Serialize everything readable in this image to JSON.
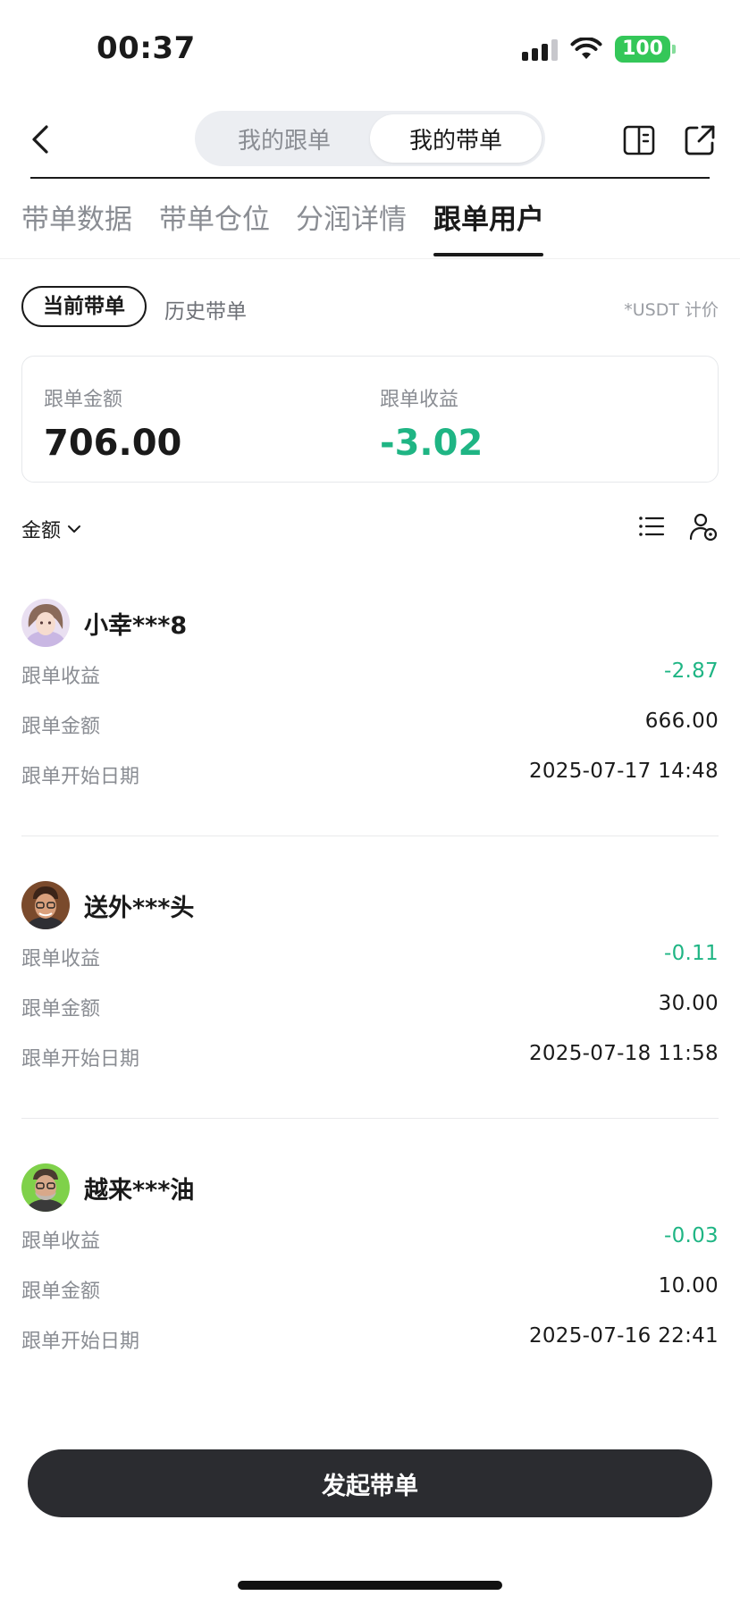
{
  "status_bar": {
    "time": "00:37",
    "battery": "100"
  },
  "header": {
    "segments": [
      "我的跟单",
      "我的带单"
    ],
    "active_segment": 1
  },
  "tabs": [
    "带单数据",
    "带单仓位",
    "分润详情",
    "跟单用户"
  ],
  "active_tab": 3,
  "filter": {
    "current": "当前带单",
    "history": "历史带单",
    "unit_note": "*USDT 计价"
  },
  "summary": {
    "amount_label": "跟单金额",
    "amount_value": "706.00",
    "pnl_label": "跟单收益",
    "pnl_value": "-3.02"
  },
  "sort": {
    "label": "金额"
  },
  "followers": [
    {
      "name": "小幸***8",
      "pnl_label": "跟单收益",
      "pnl": "-2.87",
      "amount_label": "跟单金额",
      "amount": "666.00",
      "date_label": "跟单开始日期",
      "date": "2025-07-17 14:48"
    },
    {
      "name": "送外***头",
      "pnl_label": "跟单收益",
      "pnl": "-0.11",
      "amount_label": "跟单金额",
      "amount": "30.00",
      "date_label": "跟单开始日期",
      "date": "2025-07-18 11:58"
    },
    {
      "name": "越来***油",
      "pnl_label": "跟单收益",
      "pnl": "-0.03",
      "amount_label": "跟单金额",
      "amount": "10.00",
      "date_label": "跟单开始日期",
      "date": "2025-07-16 22:41"
    }
  ],
  "cta": {
    "label": "发起带单"
  },
  "colors": {
    "negative": "#1fb584",
    "cta_bg": "#2b2c30",
    "battery": "#34c759"
  }
}
